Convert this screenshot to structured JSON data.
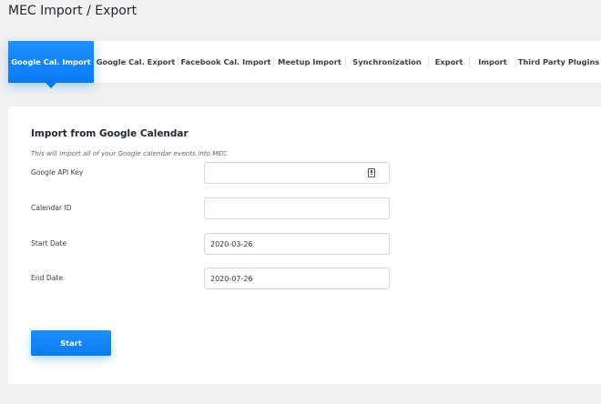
{
  "page": {
    "title": "MEC Import / Export"
  },
  "tabs": [
    {
      "label": "Google Cal. Import",
      "active": true
    },
    {
      "label": "Google Cal. Export",
      "active": false
    },
    {
      "label": "Facebook Cal. Import",
      "active": false
    },
    {
      "label": "Meetup Import",
      "active": false
    },
    {
      "label": "Synchronization",
      "active": false
    },
    {
      "label": "Export",
      "active": false
    },
    {
      "label": "Import",
      "active": false
    },
    {
      "label": "Third Party Plugins",
      "active": false
    }
  ],
  "panel": {
    "title": "Import from Google Calendar",
    "description": "This will import all of your Google calendar events into MEC.",
    "fields": {
      "api_key": {
        "label": "Google API Key",
        "value": ""
      },
      "calendar_id": {
        "label": "Calendar ID",
        "value": ""
      },
      "start_date": {
        "label": "Start Date",
        "value": "2020-03-26"
      },
      "end_date": {
        "label": "End Date",
        "value": "2020-07-26"
      }
    },
    "start_label": "Start"
  },
  "colors": {
    "accent": "#1d8cf8",
    "background": "#f1f1f1",
    "panel": "#ffffff"
  },
  "icons": {
    "api_key_field": "key-icon"
  }
}
